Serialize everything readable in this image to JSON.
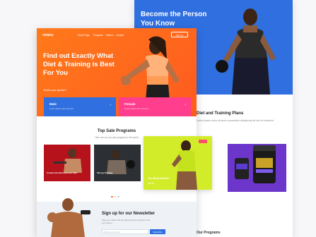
{
  "back": {
    "hero_title": "Become the Person You Know",
    "section_title": "Diet and Training Plans",
    "section_sub": "Lorem ipsum dolor sit amet consectetur adipiscing elit sed do eiusmod",
    "our_programs": "Our Programs"
  },
  "front": {
    "logo": "VENEU",
    "nav": [
      "Home Page",
      "Programs",
      "Trainers",
      "Contact"
    ],
    "nav_button": "Sign Up",
    "hero_title": "Find out Exactly What Diet & Training is Best For You",
    "gender_question": "What's your gender?",
    "gender_options": [
      {
        "label": "Male",
        "sub": "Lorem ipsum dolor sit amet"
      },
      {
        "label": "Female",
        "sub": "Lorem ipsum dolor sit amet"
      }
    ],
    "programs_title": "Top Sale Programs",
    "programs_sub": "Here are our top sale programs in the world",
    "programs": [
      {
        "caption": "Create Fast Diet Exercise Plan"
      },
      {
        "caption": "Strong Training"
      },
      {
        "caption": "The Brute Builder",
        "price": "$45.00"
      }
    ],
    "newsletter_title": "Sign up for our Newsletter",
    "newsletter_sub": "Stay up to date with the latest fitness programs and promotions",
    "email_placeholder": "Enter your email",
    "subscribe_label": "Subscribe"
  },
  "colors": {
    "orange": "#ff6b1c",
    "blue": "#2f6fe0",
    "pink": "#ff3e8e",
    "lime": "#d3ec2a",
    "purple": "#6b36c9"
  }
}
